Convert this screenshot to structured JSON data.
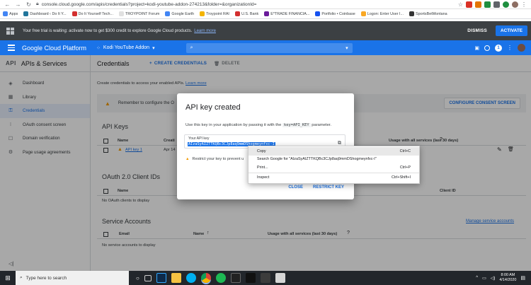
{
  "browser": {
    "url": "console.cloud.google.com/apis/credentials?project=kodi-youtube-addon-274213&folder=&organizationId="
  },
  "bookmarks": [
    {
      "label": "Apps",
      "color": "#4285f4"
    },
    {
      "label": "Dashboard ‹ Do It Y...",
      "color": "#21759b"
    },
    {
      "label": "Do It Yourself Tech...",
      "color": "#d32f2f"
    },
    {
      "label": "TROYPOINT Forum",
      "color": "#e0e0e0"
    },
    {
      "label": "Google Earth",
      "color": "#4285f4"
    },
    {
      "label": "Troypoint RAI",
      "color": "#f4b400"
    },
    {
      "label": "U.S. Bank",
      "color": "#d32f2f"
    },
    {
      "label": "E*TRADE FINANCIA...",
      "color": "#6a1b9a"
    },
    {
      "label": "Portfolio • Coinbase",
      "color": "#1652f0"
    },
    {
      "label": "Logon: Enter User I...",
      "color": "#f9a825"
    },
    {
      "label": "SportsBetMontana",
      "color": "#333333"
    }
  ],
  "trial": {
    "message": "Your free trial is waiting: activate now to get $300 credit to explore Google Cloud products.",
    "learn_more": "Learn more",
    "dismiss": "DISMISS",
    "activate": "ACTIVATE"
  },
  "header": {
    "brand": "Google Cloud Platform",
    "project": "Kodi YouTube Addon",
    "badge": "1"
  },
  "sidebar": {
    "api_tag": "API",
    "title": "APIs & Services",
    "items": [
      {
        "label": "Dashboard",
        "icon": "◈"
      },
      {
        "label": "Library",
        "icon": "▦"
      },
      {
        "label": "Credentials",
        "icon": "⚿"
      },
      {
        "label": "OAuth consent screen",
        "icon": "⁝"
      },
      {
        "label": "Domain verification",
        "icon": "☐"
      },
      {
        "label": "Page usage agreements",
        "icon": "⚙"
      }
    ],
    "collapse": "◁|"
  },
  "main": {
    "title": "Credentials",
    "create": "CREATE CREDENTIALS",
    "delete": "DELETE",
    "intro": "Create credentials to access your enabled APIs.",
    "intro_link": "Learn more",
    "consent_msg": "Remember to configure the O",
    "consent_btn": "CONFIGURE CONSENT SCREEN",
    "api_keys": {
      "heading": "API Keys",
      "col_name": "Name",
      "col_created": "Creati",
      "col_usage": "Usage with all services (last 30 days)",
      "row_name": "API key 1",
      "row_created": "Apr 14"
    },
    "oauth": {
      "heading": "OAuth 2.0 Client IDs",
      "col_name": "Name",
      "col_client": "Client ID",
      "empty": "No OAuth clients to display"
    },
    "service": {
      "heading": "Service Accounts",
      "manage": "Manage service accounts",
      "col_email": "Email",
      "col_name": "Name",
      "col_usage": "Usage with all services (last 30 days)",
      "empty": "No service accounts to display"
    }
  },
  "dialog": {
    "title": "API key created",
    "desc_before": "Use this key in your application by passing it with the",
    "desc_code": "key=API_KEY",
    "desc_after": "parameter.",
    "key_label": "Your API key",
    "key_value": "AIzaSyAIZTTKQBc3CJp8aq9mmDShogmeynfxc-I",
    "restrict": "Restrict your key to prevent u",
    "close": "CLOSE",
    "restrict_key": "RESTRICT KEY"
  },
  "context_menu": {
    "copy": "Copy",
    "copy_sc": "Ctrl+C",
    "search": "Search Google for \"AIzaSyAIZTTKQBc3CJp8aq9mmDShogmeynfxc-I\"",
    "print": "Print...",
    "print_sc": "Ctrl+P",
    "inspect": "Inspect",
    "inspect_sc": "Ctrl+Shift+I"
  },
  "taskbar": {
    "search_placeholder": "Type here to search",
    "time": "8:00 AM",
    "date": "4/14/2020"
  },
  "colors": {
    "accent": "#1a73e8",
    "banner": "#3c4043",
    "warning": "#f29900"
  }
}
